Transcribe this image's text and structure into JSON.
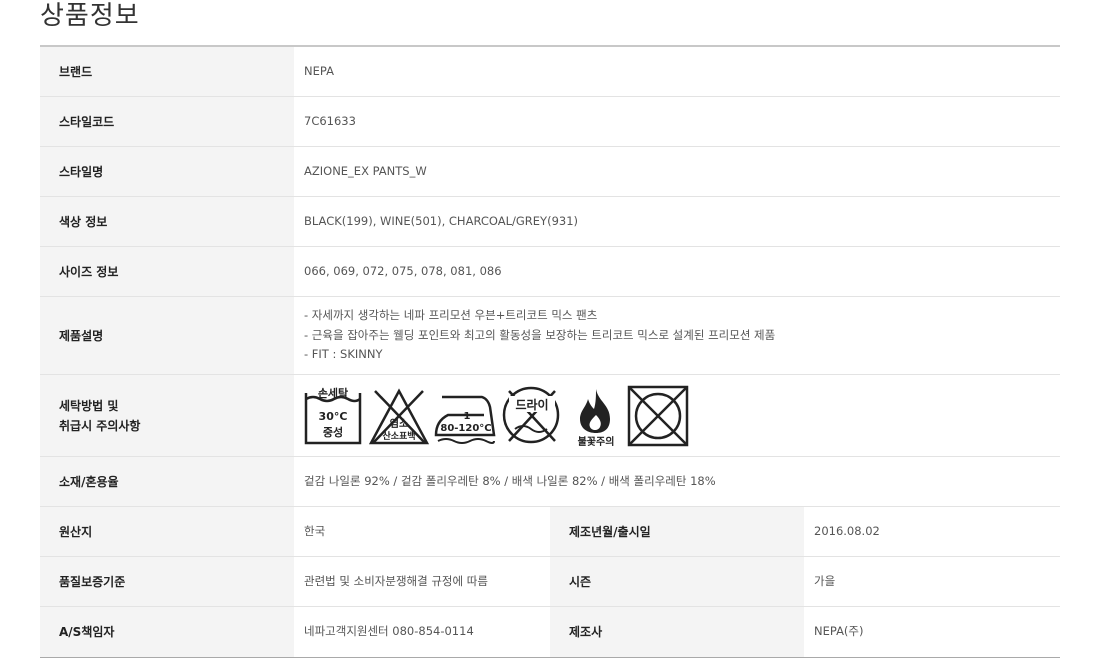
{
  "title": "상품정보",
  "rows": {
    "brand": {
      "label": "브랜드",
      "value": "NEPA"
    },
    "style_code": {
      "label": "스타일코드",
      "value": "7C61633"
    },
    "style_name": {
      "label": "스타일명",
      "value": "AZIONE_EX PANTS_W"
    },
    "color": {
      "label": "색상 정보",
      "value": "BLACK(199), WINE(501), CHARCOAL/GREY(931)"
    },
    "size": {
      "label": "사이즈 정보",
      "value": "066, 069, 072, 075, 078, 081, 086"
    },
    "description": {
      "label": "제품설명",
      "lines": [
        "- 자세까지 생각하는 네파 프리모션 우븐+트리코트 믹스 팬츠",
        "- 근육을 잡아주는 웰딩 포인트와 최고의 활동성을 보장하는 트리코트 믹스로 설계된 프리모션 제품",
        "- FIT : SKINNY"
      ]
    },
    "care": {
      "label_line1": "세탁방법 및",
      "label_line2": "취급시 주의사항",
      "icons": [
        {
          "name": "hand-wash-icon",
          "text1": "손세탁",
          "text2": "30°C",
          "text3": "중성"
        },
        {
          "name": "no-chlorine-bleach-icon",
          "text1": "염소",
          "text2": "산소표백"
        },
        {
          "name": "iron-icon",
          "text1": "1",
          "text2": "80-120°C"
        },
        {
          "name": "no-dry-clean-icon",
          "text1": "드라이"
        },
        {
          "name": "flame-caution-icon",
          "text1": "불꽃주의"
        },
        {
          "name": "no-tumble-dry-icon"
        }
      ]
    },
    "material": {
      "label": "소재/혼용율",
      "value": "겉감 나일론 92% / 겉감 폴리우레탄 8% / 배색 나일론 82% / 배색 폴리우레탄 18%"
    },
    "origin": {
      "label": "원산지",
      "value": "한국",
      "label2": "제조년월/출시일",
      "value2": "2016.08.02"
    },
    "quality": {
      "label": "품질보증기준",
      "value": "관련법 및 소비자분쟁해결 규정에 따름",
      "label2": "시즌",
      "value2": "가을"
    },
    "as": {
      "label": "A/S책임자",
      "value": "네파고객지원센터 080-854-0114",
      "label2": "제조사",
      "value2": "NEPA(주)"
    }
  }
}
